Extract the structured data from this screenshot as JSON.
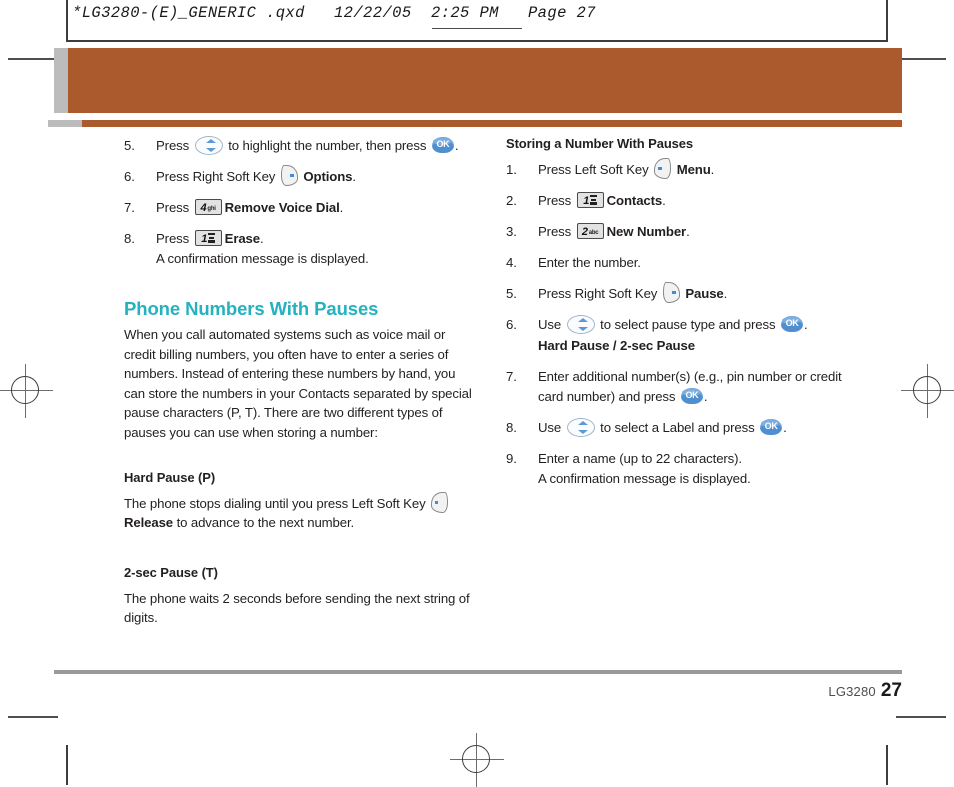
{
  "header": {
    "file_line": "*LG3280-(E)_GENERIC .qxd   12/22/05  2:25 PM   Page 27"
  },
  "left_column": {
    "continued_steps": [
      {
        "num": "5.",
        "parts": [
          {
            "type": "text",
            "value": "Press "
          },
          {
            "type": "icon",
            "icon": "nav-updown-key-icon"
          },
          {
            "type": "text",
            "value": " to highlight the number, then press "
          },
          {
            "type": "icon",
            "icon": "ok-key-icon"
          },
          {
            "type": "text",
            "value": "."
          }
        ]
      },
      {
        "num": "6.",
        "parts": [
          {
            "type": "text",
            "value": "Press Right Soft Key "
          },
          {
            "type": "icon",
            "icon": "right-soft-key-icon"
          },
          {
            "type": "bold",
            "value": " Options"
          },
          {
            "type": "text",
            "value": "."
          }
        ]
      },
      {
        "num": "7.",
        "parts": [
          {
            "type": "text",
            "value": "Press "
          },
          {
            "type": "icon",
            "icon": "keypad-4-ghi-icon",
            "digit": "4",
            "letters": "ghi"
          },
          {
            "type": "bold",
            "value": "Remove Voice Dial"
          },
          {
            "type": "text",
            "value": "."
          }
        ]
      },
      {
        "num": "8.",
        "parts": [
          {
            "type": "text",
            "value": "Press "
          },
          {
            "type": "icon",
            "icon": "keypad-1-voicemail-icon",
            "digit": "1",
            "letters": ""
          },
          {
            "type": "bold",
            "value": "Erase"
          },
          {
            "type": "text",
            "value": "."
          }
        ],
        "extra_line": "A confirmation message is displayed."
      }
    ],
    "section": {
      "title": "Phone Numbers With Pauses",
      "intro": "When you call automated systems such as voice mail or credit billing numbers, you often have to enter a series of numbers. Instead of entering these numbers by hand, you can store the numbers in your Contacts separated by special pause characters (P, T). There are two different types of pauses you can use when storing a number:",
      "hard_pause": {
        "heading": "Hard Pause (P)",
        "text_before": "The phone stops dialing until you press Left Soft Key ",
        "icon": "left-soft-key-icon",
        "bold": "Release",
        "text_after": " to advance to the next number."
      },
      "two_sec_pause": {
        "heading": "2-sec Pause (T)",
        "text": "The phone waits 2 seconds before sending the next string of digits."
      }
    }
  },
  "right_column": {
    "title": "Storing a Number With Pauses",
    "steps": [
      {
        "num": "1.",
        "parts": [
          {
            "type": "text",
            "value": "Press Left Soft Key "
          },
          {
            "type": "icon",
            "icon": "left-soft-key-icon"
          },
          {
            "type": "bold",
            "value": " Menu"
          },
          {
            "type": "text",
            "value": "."
          }
        ]
      },
      {
        "num": "2.",
        "parts": [
          {
            "type": "text",
            "value": "Press "
          },
          {
            "type": "icon",
            "icon": "keypad-1-voicemail-icon",
            "digit": "1",
            "letters": ""
          },
          {
            "type": "bold",
            "value": "Contacts"
          },
          {
            "type": "text",
            "value": "."
          }
        ]
      },
      {
        "num": "3.",
        "parts": [
          {
            "type": "text",
            "value": "Press "
          },
          {
            "type": "icon",
            "icon": "keypad-2-abc-icon",
            "digit": "2",
            "letters": "abc"
          },
          {
            "type": "bold",
            "value": "New Number"
          },
          {
            "type": "text",
            "value": "."
          }
        ]
      },
      {
        "num": "4.",
        "parts": [
          {
            "type": "text",
            "value": "Enter the number."
          }
        ]
      },
      {
        "num": "5.",
        "parts": [
          {
            "type": "text",
            "value": "Press Right Soft Key "
          },
          {
            "type": "icon",
            "icon": "right-soft-key-icon"
          },
          {
            "type": "bold",
            "value": " Pause"
          },
          {
            "type": "text",
            "value": "."
          }
        ]
      },
      {
        "num": "6.",
        "parts": [
          {
            "type": "text",
            "value": "Use "
          },
          {
            "type": "icon",
            "icon": "nav-updown-key-icon"
          },
          {
            "type": "text",
            "value": " to select pause type and press "
          },
          {
            "type": "icon",
            "icon": "ok-key-icon"
          },
          {
            "type": "text",
            "value": "."
          }
        ],
        "bold_line": "Hard Pause / 2-sec Pause"
      },
      {
        "num": "7.",
        "parts": [
          {
            "type": "text",
            "value": "Enter additional number(s) (e.g., pin number or credit card number) and press "
          },
          {
            "type": "icon",
            "icon": "ok-key-icon"
          },
          {
            "type": "text",
            "value": "."
          }
        ]
      },
      {
        "num": "8.",
        "parts": [
          {
            "type": "text",
            "value": "Use "
          },
          {
            "type": "icon",
            "icon": "nav-updown-key-icon"
          },
          {
            "type": "text",
            "value": " to select a Label and press "
          },
          {
            "type": "icon",
            "icon": "ok-key-icon"
          },
          {
            "type": "text",
            "value": "."
          }
        ]
      },
      {
        "num": "9.",
        "parts": [
          {
            "type": "text",
            "value": "Enter a name (up to 22 characters)."
          }
        ],
        "extra_line": "A confirmation message is displayed."
      }
    ]
  },
  "footer": {
    "model": "LG3280",
    "page_number": "27"
  },
  "colors": {
    "banner_orange": "#ab5a2d",
    "banner_tab_grey": "#bcbcbc",
    "heading_teal": "#23b2be",
    "ok_key_blue": "#4f8fd0",
    "nav_arrow_blue": "#5c9ad6",
    "body_text": "#231f20",
    "footer_rule": "#9a9a9a"
  },
  "icons": {
    "ok_label": "OK"
  }
}
